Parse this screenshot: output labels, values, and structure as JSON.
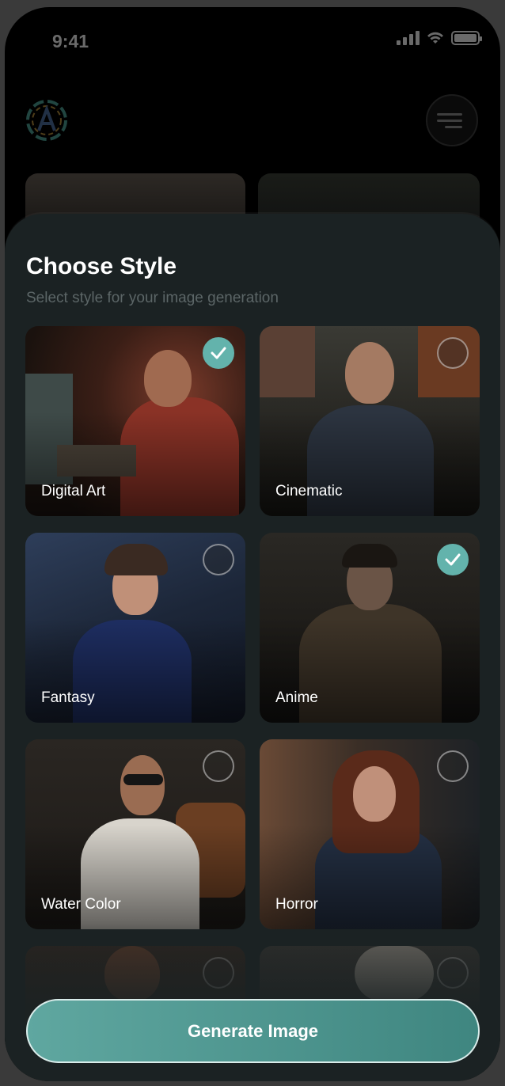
{
  "status_bar": {
    "time": "9:41"
  },
  "sheet": {
    "title": "Choose Style",
    "subtitle": "Select style for your image generation"
  },
  "styles": [
    {
      "label": "Digital Art",
      "selected": true
    },
    {
      "label": "Cinematic",
      "selected": false
    },
    {
      "label": "Fantasy",
      "selected": false
    },
    {
      "label": "Anime",
      "selected": true
    },
    {
      "label": "Water Color",
      "selected": false
    },
    {
      "label": "Horror",
      "selected": false
    }
  ],
  "generate_button": {
    "label": "Generate Image"
  },
  "colors": {
    "accent": "#63b3ac",
    "sheet_bg": "#1b2223",
    "button_gradient": [
      "#5fa7a0",
      "#3f8680"
    ]
  }
}
